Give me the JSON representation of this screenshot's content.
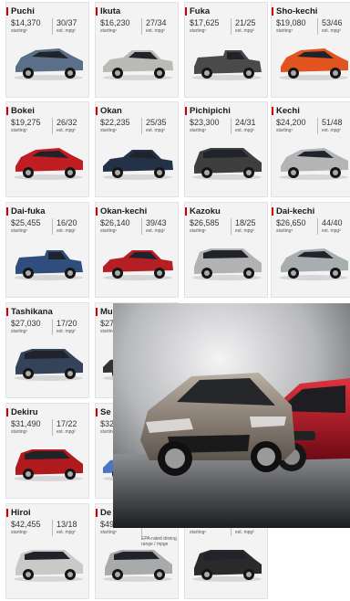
{
  "cars": [
    {
      "name": "Puchi",
      "price": "$14,370",
      "mpg": "30/37",
      "price_caption": "starting¹",
      "mpg_caption": "est. mpg²",
      "color": "#5b6f88",
      "type": "hatch"
    },
    {
      "name": "Ikuta",
      "price": "$16,230",
      "mpg": "27/34",
      "price_caption": "starting¹",
      "mpg_caption": "est. mpg²",
      "color": "#b9b9b6",
      "type": "sedan"
    },
    {
      "name": "Fuka",
      "price": "$17,625",
      "mpg": "21/25",
      "price_caption": "starting¹",
      "mpg_caption": "est. mpg²",
      "color": "#4a4a4a",
      "type": "truck"
    },
    {
      "name": "Sho-kechi",
      "price": "$19,080",
      "mpg": "53/46",
      "price_caption": "starting¹",
      "mpg_caption": "est. mpg²",
      "color": "#e2541f",
      "type": "hatch"
    },
    {
      "name": "Bokei",
      "price": "$19,275",
      "mpg": "26/32",
      "price_caption": "starting¹",
      "mpg_caption": "est. mpg²",
      "color": "#c01d22",
      "type": "hatch"
    },
    {
      "name": "Okan",
      "price": "$22,235",
      "mpg": "25/35",
      "price_caption": "starting¹",
      "mpg_caption": "est. mpg²",
      "color": "#243247",
      "type": "sedan"
    },
    {
      "name": "Pichipichi",
      "price": "$23,300",
      "mpg": "24/31",
      "price_caption": "starting¹",
      "mpg_caption": "est. mpg²",
      "color": "#3e3e3f",
      "type": "suv"
    },
    {
      "name": "Kechi",
      "price": "$24,200",
      "mpg": "51/48",
      "price_caption": "starting¹",
      "mpg_caption": "est. mpg²",
      "color": "#b2b4b5",
      "type": "hatch"
    },
    {
      "name": "Dai-fuka",
      "price": "$25,455",
      "mpg": "16/20",
      "price_caption": "starting¹",
      "mpg_caption": "est. mpg²",
      "color": "#2f4e7d",
      "type": "truck"
    },
    {
      "name": "Okan-kechi",
      "price": "$26,140",
      "mpg": "39/43",
      "price_caption": "starting¹",
      "mpg_caption": "est. mpg²",
      "color": "#b51f23",
      "type": "sedan"
    },
    {
      "name": "Kazoku",
      "price": "$26,585",
      "mpg": "18/25",
      "price_caption": "starting¹",
      "mpg_caption": "est. mpg²",
      "color": "#b2b2b4",
      "type": "van"
    },
    {
      "name": "Dai-kechi",
      "price": "$26,650",
      "mpg": "44/40",
      "price_caption": "starting¹",
      "mpg_caption": "est. mpg²",
      "color": "#a8aeaf",
      "type": "hatch"
    },
    {
      "name": "Tashikana",
      "price": "$27,030",
      "mpg": "17/20",
      "price_caption": "starting¹",
      "mpg_caption": "est. mpg²",
      "color": "#34425a",
      "type": "suv"
    },
    {
      "name": "Mu",
      "price": "$27",
      "mpg": "",
      "price_caption": "starting¹",
      "mpg_caption": "",
      "color": "#333333",
      "type": "sedan"
    },
    {
      "name": "",
      "price": "",
      "mpg": "",
      "price_caption": "",
      "mpg_caption": "",
      "color": "",
      "type": "none"
    },
    {
      "name": "",
      "price": "",
      "mpg": "",
      "price_caption": "",
      "mpg_caption": "",
      "color": "",
      "type": "none"
    },
    {
      "name": "Dekiru",
      "price": "$31,490",
      "mpg": "17/22",
      "price_caption": "starting¹",
      "mpg_caption": "est. mpg²",
      "color": "#b11a1d",
      "type": "suv"
    },
    {
      "name": "Se",
      "price": "$32",
      "mpg": "",
      "price_caption": "starting¹",
      "mpg_caption": "",
      "color": "#4a78c0",
      "type": "sedan"
    },
    {
      "name": "",
      "price": "",
      "mpg": "",
      "price_caption": "",
      "mpg_caption": "",
      "color": "",
      "type": "none"
    },
    {
      "name": "",
      "price": "",
      "mpg": "",
      "price_caption": "",
      "mpg_caption": "",
      "color": "",
      "type": "none"
    },
    {
      "name": "Hiroi",
      "price": "$42,455",
      "mpg": "13/18",
      "price_caption": "starting¹",
      "mpg_caption": "est. mpg²",
      "color": "#c9c9c7",
      "type": "suv"
    },
    {
      "name": "De",
      "price": "$49",
      "mpg": "",
      "price_caption": "starting¹",
      "mpg_caption": "",
      "color": "#a9aaab",
      "type": "suv"
    },
    {
      "name": "",
      "price": "",
      "mpg": "",
      "price_caption": "starting¹",
      "mpg_caption": "est. mpg²",
      "color": "#2a2a2a",
      "type": "suv"
    },
    {
      "name": "",
      "price": "",
      "mpg": "",
      "price_caption": "",
      "mpg_caption": "",
      "color": "",
      "type": "none"
    }
  ],
  "range_note": "EPA-rated driving range / mpge",
  "overlay_image": "car-promo-photo"
}
